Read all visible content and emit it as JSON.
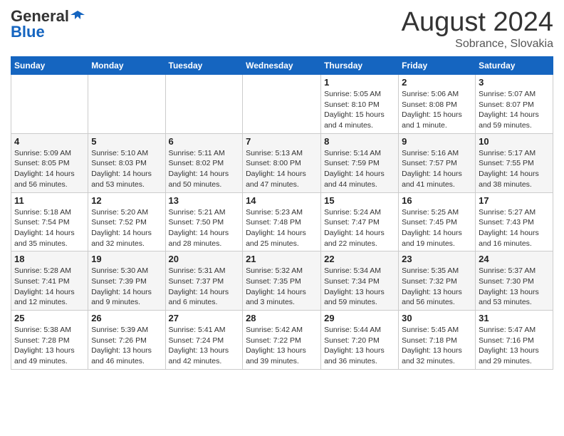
{
  "header": {
    "logo_general": "General",
    "logo_blue": "Blue",
    "month": "August 2024",
    "location": "Sobrance, Slovakia"
  },
  "days_of_week": [
    "Sunday",
    "Monday",
    "Tuesday",
    "Wednesday",
    "Thursday",
    "Friday",
    "Saturday"
  ],
  "weeks": [
    [
      {
        "day": "",
        "info": ""
      },
      {
        "day": "",
        "info": ""
      },
      {
        "day": "",
        "info": ""
      },
      {
        "day": "",
        "info": ""
      },
      {
        "day": "1",
        "info": "Sunrise: 5:05 AM\nSunset: 8:10 PM\nDaylight: 15 hours\nand 4 minutes."
      },
      {
        "day": "2",
        "info": "Sunrise: 5:06 AM\nSunset: 8:08 PM\nDaylight: 15 hours\nand 1 minute."
      },
      {
        "day": "3",
        "info": "Sunrise: 5:07 AM\nSunset: 8:07 PM\nDaylight: 14 hours\nand 59 minutes."
      }
    ],
    [
      {
        "day": "4",
        "info": "Sunrise: 5:09 AM\nSunset: 8:05 PM\nDaylight: 14 hours\nand 56 minutes."
      },
      {
        "day": "5",
        "info": "Sunrise: 5:10 AM\nSunset: 8:03 PM\nDaylight: 14 hours\nand 53 minutes."
      },
      {
        "day": "6",
        "info": "Sunrise: 5:11 AM\nSunset: 8:02 PM\nDaylight: 14 hours\nand 50 minutes."
      },
      {
        "day": "7",
        "info": "Sunrise: 5:13 AM\nSunset: 8:00 PM\nDaylight: 14 hours\nand 47 minutes."
      },
      {
        "day": "8",
        "info": "Sunrise: 5:14 AM\nSunset: 7:59 PM\nDaylight: 14 hours\nand 44 minutes."
      },
      {
        "day": "9",
        "info": "Sunrise: 5:16 AM\nSunset: 7:57 PM\nDaylight: 14 hours\nand 41 minutes."
      },
      {
        "day": "10",
        "info": "Sunrise: 5:17 AM\nSunset: 7:55 PM\nDaylight: 14 hours\nand 38 minutes."
      }
    ],
    [
      {
        "day": "11",
        "info": "Sunrise: 5:18 AM\nSunset: 7:54 PM\nDaylight: 14 hours\nand 35 minutes."
      },
      {
        "day": "12",
        "info": "Sunrise: 5:20 AM\nSunset: 7:52 PM\nDaylight: 14 hours\nand 32 minutes."
      },
      {
        "day": "13",
        "info": "Sunrise: 5:21 AM\nSunset: 7:50 PM\nDaylight: 14 hours\nand 28 minutes."
      },
      {
        "day": "14",
        "info": "Sunrise: 5:23 AM\nSunset: 7:48 PM\nDaylight: 14 hours\nand 25 minutes."
      },
      {
        "day": "15",
        "info": "Sunrise: 5:24 AM\nSunset: 7:47 PM\nDaylight: 14 hours\nand 22 minutes."
      },
      {
        "day": "16",
        "info": "Sunrise: 5:25 AM\nSunset: 7:45 PM\nDaylight: 14 hours\nand 19 minutes."
      },
      {
        "day": "17",
        "info": "Sunrise: 5:27 AM\nSunset: 7:43 PM\nDaylight: 14 hours\nand 16 minutes."
      }
    ],
    [
      {
        "day": "18",
        "info": "Sunrise: 5:28 AM\nSunset: 7:41 PM\nDaylight: 14 hours\nand 12 minutes."
      },
      {
        "day": "19",
        "info": "Sunrise: 5:30 AM\nSunset: 7:39 PM\nDaylight: 14 hours\nand 9 minutes."
      },
      {
        "day": "20",
        "info": "Sunrise: 5:31 AM\nSunset: 7:37 PM\nDaylight: 14 hours\nand 6 minutes."
      },
      {
        "day": "21",
        "info": "Sunrise: 5:32 AM\nSunset: 7:35 PM\nDaylight: 14 hours\nand 3 minutes."
      },
      {
        "day": "22",
        "info": "Sunrise: 5:34 AM\nSunset: 7:34 PM\nDaylight: 13 hours\nand 59 minutes."
      },
      {
        "day": "23",
        "info": "Sunrise: 5:35 AM\nSunset: 7:32 PM\nDaylight: 13 hours\nand 56 minutes."
      },
      {
        "day": "24",
        "info": "Sunrise: 5:37 AM\nSunset: 7:30 PM\nDaylight: 13 hours\nand 53 minutes."
      }
    ],
    [
      {
        "day": "25",
        "info": "Sunrise: 5:38 AM\nSunset: 7:28 PM\nDaylight: 13 hours\nand 49 minutes."
      },
      {
        "day": "26",
        "info": "Sunrise: 5:39 AM\nSunset: 7:26 PM\nDaylight: 13 hours\nand 46 minutes."
      },
      {
        "day": "27",
        "info": "Sunrise: 5:41 AM\nSunset: 7:24 PM\nDaylight: 13 hours\nand 42 minutes."
      },
      {
        "day": "28",
        "info": "Sunrise: 5:42 AM\nSunset: 7:22 PM\nDaylight: 13 hours\nand 39 minutes."
      },
      {
        "day": "29",
        "info": "Sunrise: 5:44 AM\nSunset: 7:20 PM\nDaylight: 13 hours\nand 36 minutes."
      },
      {
        "day": "30",
        "info": "Sunrise: 5:45 AM\nSunset: 7:18 PM\nDaylight: 13 hours\nand 32 minutes."
      },
      {
        "day": "31",
        "info": "Sunrise: 5:47 AM\nSunset: 7:16 PM\nDaylight: 13 hours\nand 29 minutes."
      }
    ]
  ]
}
